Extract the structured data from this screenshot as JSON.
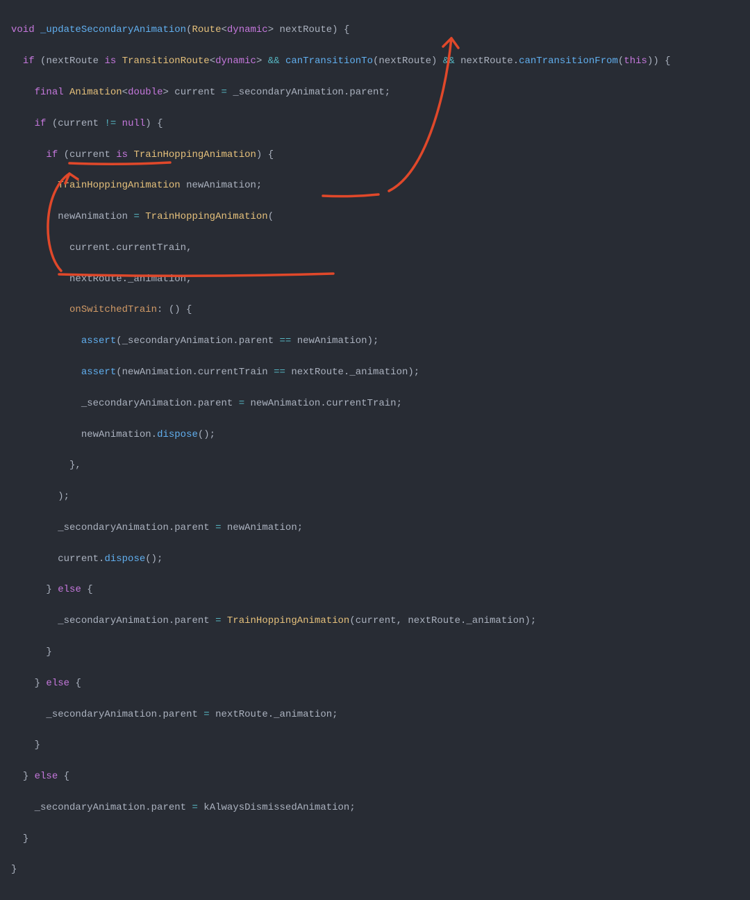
{
  "colors": {
    "bg": "#282c34",
    "fg": "#abb2bf",
    "keyword": "#c678dd",
    "type": "#e5c07b",
    "method": "#61afef",
    "operator": "#56b6c2",
    "param": "#d19a66",
    "this": "#e06c75",
    "annotation": "#e0482a"
  },
  "tokens": {
    "void": "void",
    "if": "if",
    "is": "is",
    "final": "final",
    "else": "else",
    "this": "this",
    "null": "null",
    "dynamic": "dynamic",
    "double": "double",
    "fn_updateSecondaryAnimation": "_updateSecondaryAnimation",
    "Route": "Route",
    "nextRoute": "nextRoute",
    "TransitionRoute": "TransitionRoute",
    "canTransitionTo": "canTransitionTo",
    "canTransitionFrom": "canTransitionFrom",
    "Animation": "Animation",
    "current": "current",
    "_secondaryAnimation": "_secondaryAnimation",
    "parent": "parent",
    "TrainHoppingAnimation": "TrainHoppingAnimation",
    "newAnimation": "newAnimation",
    "currentTrain": "currentTrain",
    "_animation": "_animation",
    "onSwitchedTrain": "onSwitchedTrain",
    "assert": "assert",
    "dispose": "dispose",
    "kAlwaysDismissedAnimation": "kAlwaysDismissedAnimation",
    "amp": "&&",
    "eqeq": "==",
    "neq": "!=",
    "eq": "="
  }
}
